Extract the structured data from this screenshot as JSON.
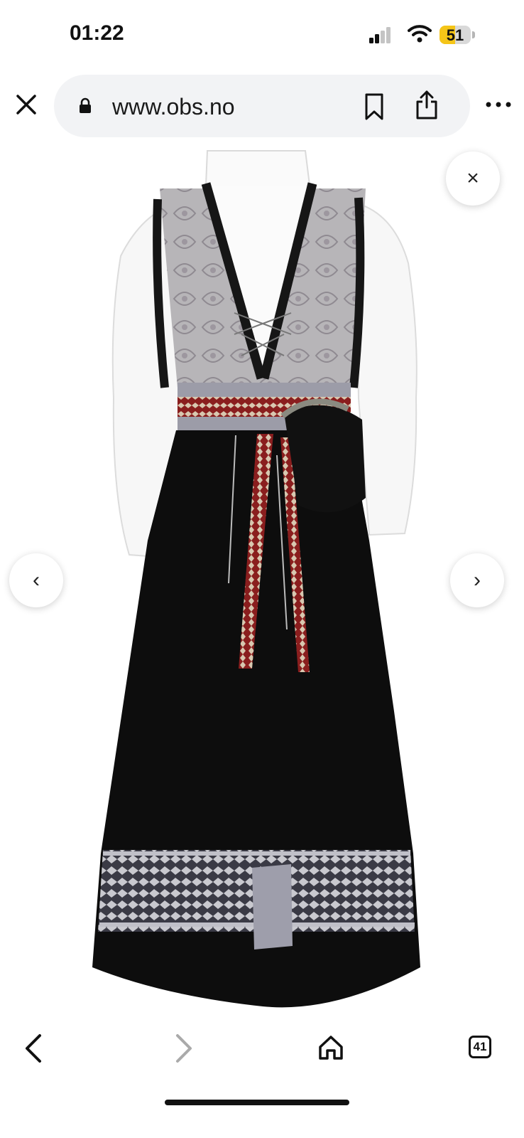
{
  "status_bar": {
    "time": "01:22",
    "battery": "51",
    "battery_color": "#f5c518"
  },
  "browser": {
    "url": "www.obs.no",
    "close_icon": "close-icon",
    "lock_icon": "lock-icon",
    "bookmark_icon": "bookmark-icon",
    "share_icon": "share-icon",
    "more_icon": "more-icon"
  },
  "lightbox": {
    "close_symbol": "×",
    "prev_symbol": "‹",
    "next_symbol": "›"
  },
  "toolbar": {
    "back_icon": "chevron-left-icon",
    "forward_icon": "chevron-right-icon",
    "home_icon": "home-icon",
    "tab_count": "41"
  }
}
